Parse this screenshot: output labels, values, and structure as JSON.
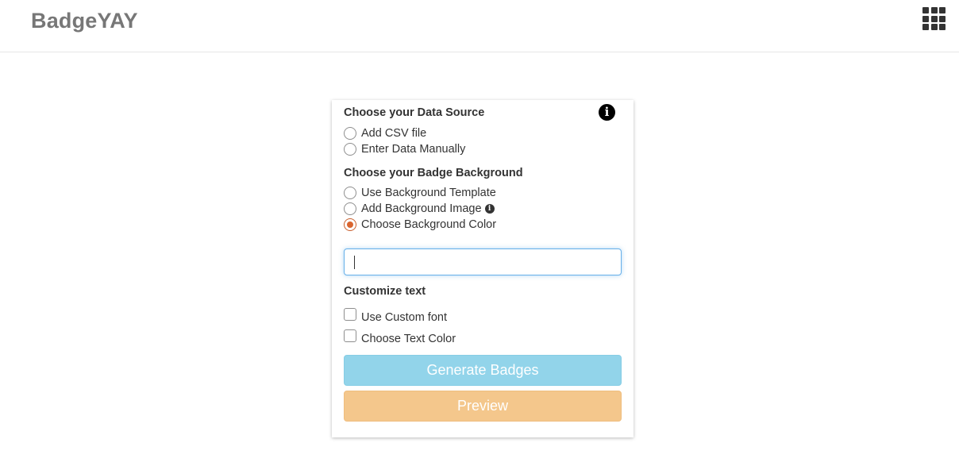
{
  "navbar": {
    "brand": "BadgeYAY",
    "apps_icon": "grid-apps-icon"
  },
  "form": {
    "data_source": {
      "title": "Choose your Data Source",
      "info_icon": "info-circle-icon",
      "options": [
        {
          "label": "Add CSV file",
          "checked": false
        },
        {
          "label": "Enter Data Manually",
          "checked": false
        }
      ]
    },
    "background": {
      "title": "Choose your Badge Background",
      "options": [
        {
          "label": "Use Background Template",
          "checked": false
        },
        {
          "label": "Add Background Image",
          "checked": false,
          "info_icon": "info-circle-icon"
        },
        {
          "label": "Choose Background Color",
          "checked": true
        }
      ],
      "color_input": {
        "value": "",
        "placeholder": ""
      }
    },
    "customize_text": {
      "title": "Customize text",
      "options": [
        {
          "label": "Use Custom font",
          "checked": false
        },
        {
          "label": "Choose Text Color",
          "checked": false
        }
      ]
    },
    "buttons": {
      "generate": "Generate Badges",
      "preview": "Preview"
    }
  },
  "colors": {
    "brand_text": "#777777",
    "radio_checked": "#d9652f",
    "input_focus": "#66afe9",
    "generate_button": "#92d4ea",
    "preview_button": "#f4c78c"
  }
}
